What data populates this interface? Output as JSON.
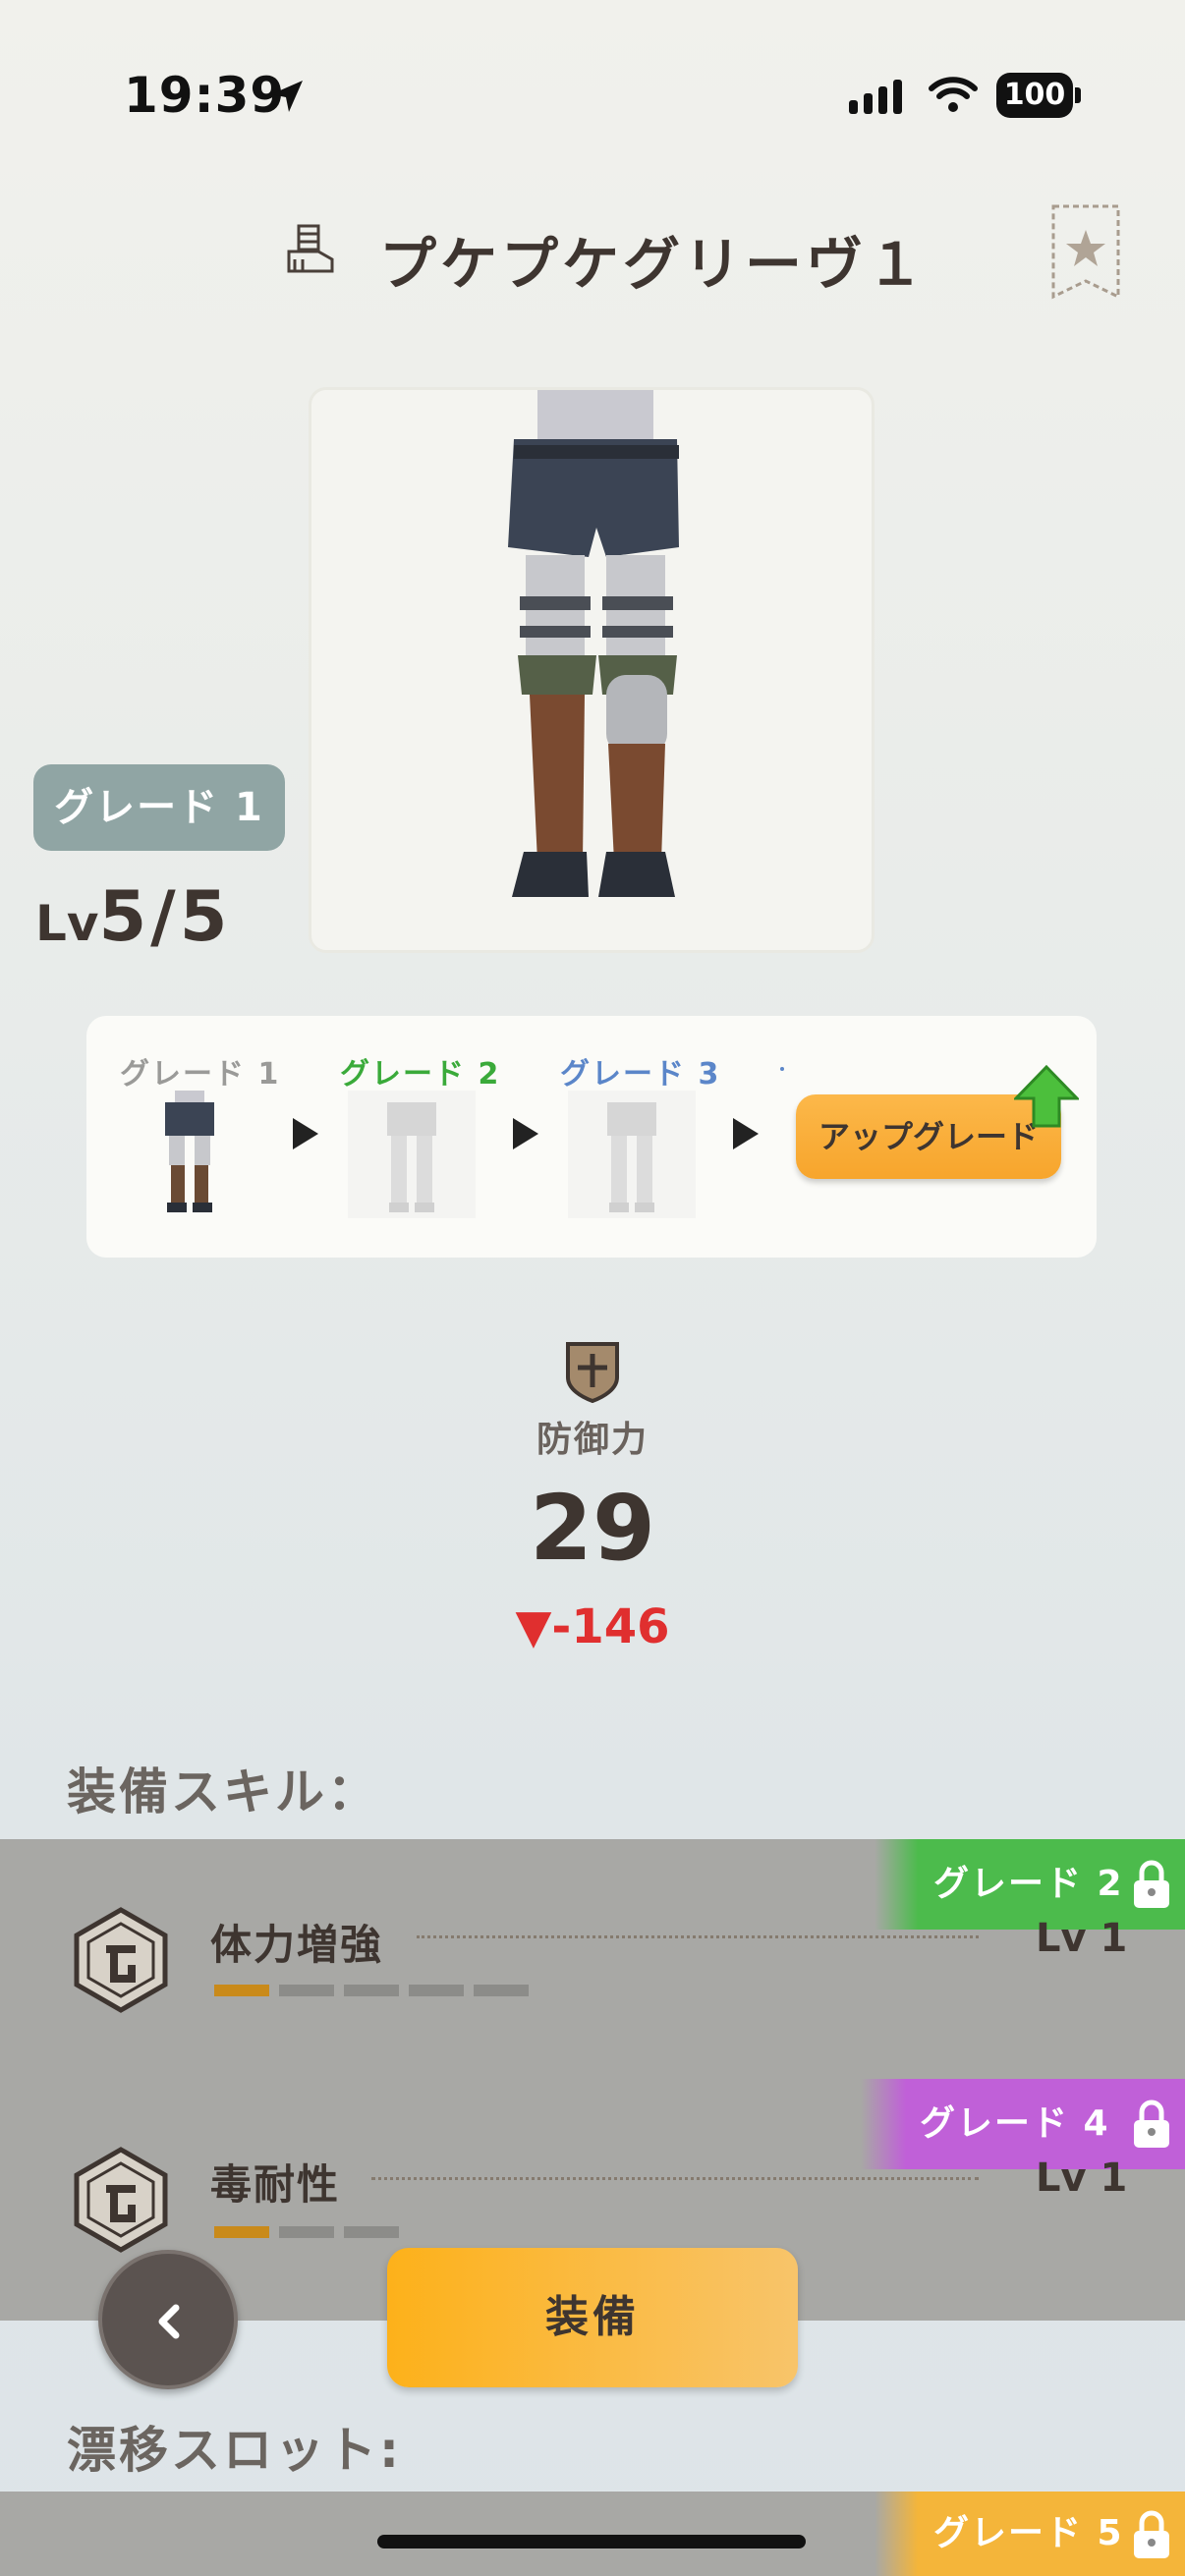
{
  "status_bar": {
    "time": "19:39",
    "battery": "100",
    "icons": [
      "location-arrow-icon",
      "signal-icon",
      "wifi-icon",
      "battery-icon"
    ]
  },
  "header": {
    "title": "プケプケグリーヴ１",
    "title_icon": "leg-armor-icon",
    "favorite_icon": "star-bookmark-icon"
  },
  "item": {
    "grade_badge": "グレード 1",
    "level_prefix": "Lv",
    "level_value": "5/5"
  },
  "grades": {
    "items": [
      {
        "label": "グレード 1",
        "color": "#9a9a98"
      },
      {
        "label": "グレード 2",
        "color": "#3aaa3a"
      },
      {
        "label": "グレード 3",
        "color": "#5b86c9"
      }
    ],
    "upgrade_label": "アップグレード",
    "upgrade_color": "#f7a52c"
  },
  "defense": {
    "label": "防御力",
    "value": "29",
    "diff": "▼-146",
    "diff_color": "#e02f2f"
  },
  "skills": {
    "heading": "装備スキル：",
    "items": [
      {
        "name": "体力増強",
        "level": "Lv 1",
        "lock_grade": "グレード 2",
        "lock_color": "#4cbb4c",
        "filled": 1,
        "total": 5
      },
      {
        "name": "毒耐性",
        "level": "Lv 1",
        "lock_grade": "グレード 4",
        "lock_color": "#c060d8",
        "filled": 1,
        "total": 3
      }
    ]
  },
  "actions": {
    "back_icon": "chevron-left-icon",
    "equip_label": "装備"
  },
  "drift": {
    "heading": "漂移スロット:",
    "lock_grade": "グレード 5",
    "lock_color": "#f4b53a"
  }
}
